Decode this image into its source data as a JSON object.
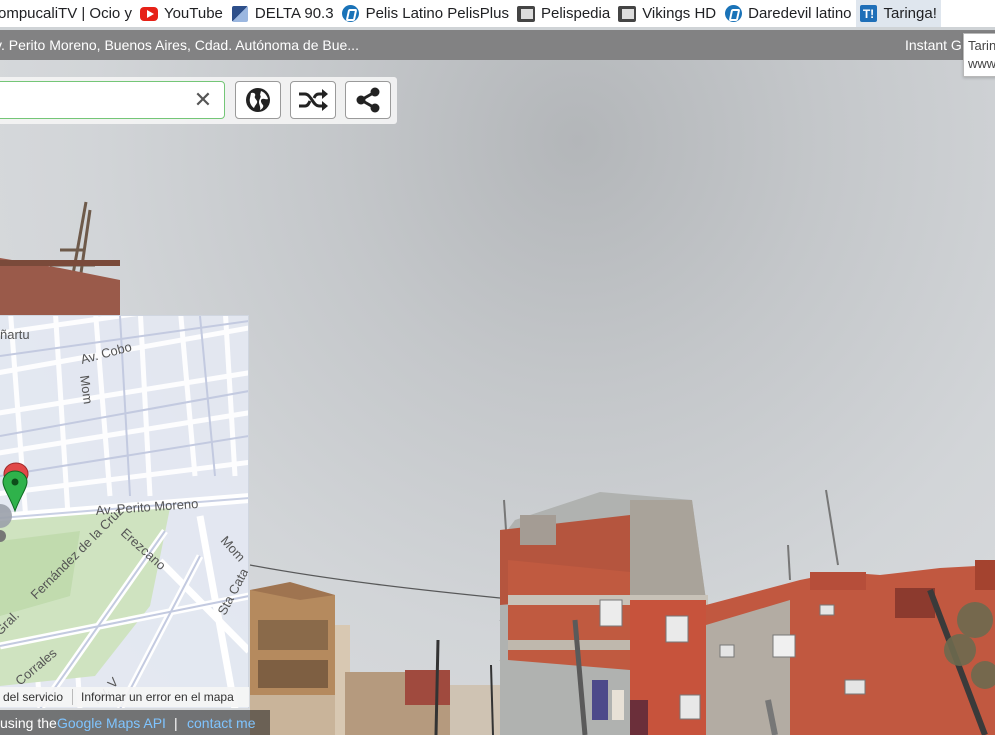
{
  "bookmarks": [
    {
      "label": "ompucaliTV | Ocio y",
      "icon": "bookmark-icon"
    },
    {
      "label": "YouTube",
      "icon": "youtube-icon"
    },
    {
      "label": "DELTA 90.3",
      "icon": "delta-icon"
    },
    {
      "label": "Pelis Latino PelisPlus",
      "icon": "pelisplus-icon"
    },
    {
      "label": "Pelispedia",
      "icon": "film-icon"
    },
    {
      "label": "Vikings HD",
      "icon": "film-icon"
    },
    {
      "label": "Daredevil  latino",
      "icon": "pelisplus-icon"
    },
    {
      "label": "Taringa!",
      "icon": "taringa-icon"
    }
  ],
  "address_bar": {
    "address": "v. Perito Moreno, Buenos Aires, Cdad. Autónoma de Bue...",
    "right_text": "Instant G"
  },
  "tooltip": {
    "line1": "Tarin",
    "line2": "www"
  },
  "toolbar": {
    "search_value": "",
    "clear_label": "✕",
    "globe_icon": "globe-icon",
    "shuffle_icon": "shuffle-icon",
    "share_icon": "share-icon"
  },
  "minimap": {
    "streets": {
      "narrow": "ñartu",
      "cobo": "Av. Cobo",
      "mom1": "Mom",
      "perito": "Av. Perito Moreno",
      "cruz": "Fernández de la Cruz",
      "gral": "Gral.",
      "erezcano": "Erezcano",
      "mom2": "Mom",
      "stacat": "Sta Cata",
      "corrales": "Corrales",
      "avv": "Av. V"
    },
    "footer": {
      "terms": "del servicio",
      "report": "Informar un error en el mapa"
    }
  },
  "credits": {
    "prefix": "using the",
    "api_link": "Google Maps API",
    "sep": "|",
    "contact_link": "contact me"
  },
  "colors": {
    "search_border": "#74c677",
    "pin_green": "#2fb24b",
    "pin_red": "#e14848",
    "link": "#7fc4ff"
  }
}
